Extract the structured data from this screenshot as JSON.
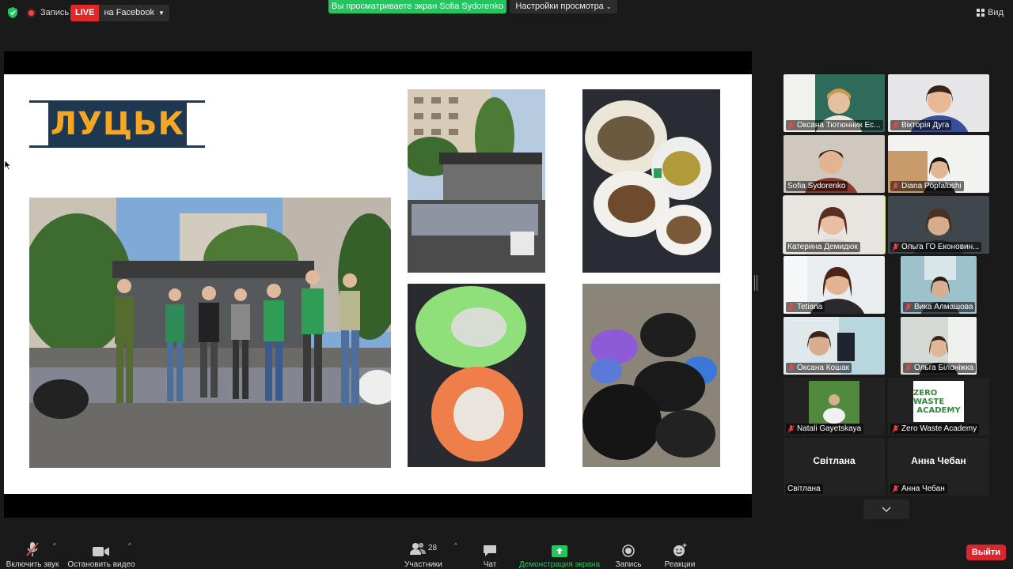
{
  "topbar": {
    "record_label": "Запись",
    "live_badge": "LIVE",
    "live_target": "на Facebook",
    "viewing_banner": "Вы просматриваете экран Sofia Sydorenko",
    "view_options": "Настройки просмотра",
    "view_label": "Вид"
  },
  "slide": {
    "logo_text": "ЛУЦЬК"
  },
  "gallery": {
    "participants": [
      {
        "name": "Оксана Тютюнник Ec...",
        "muted": true
      },
      {
        "name": "Вікторія Дуга",
        "muted": true
      },
      {
        "name": "Sofia Sydorenko",
        "muted": false
      },
      {
        "name": "Diana Popfalushi",
        "muted": true
      },
      {
        "name": "Катерина Демидюк",
        "muted": false,
        "active": true
      },
      {
        "name": "Ольга  ГО Еконовин...",
        "muted": true
      },
      {
        "name": "Tetiana",
        "muted": true
      },
      {
        "name": "Вика Алмашова",
        "muted": true
      },
      {
        "name": "Оксана Кошак",
        "muted": true
      },
      {
        "name": "Ольга Білонiжка",
        "muted": true
      },
      {
        "name": "Natali Gayetskaya",
        "muted": true
      },
      {
        "name": "Zero Waste Academy",
        "muted": true
      },
      {
        "name": "Світлана",
        "muted": false,
        "display": "Світлана"
      },
      {
        "name": "Анна Чебан",
        "muted": true,
        "display": "Анна Чебан"
      }
    ],
    "zwa_logo_line1": "ZERO WASTE",
    "zwa_logo_line2": "ACADEMY"
  },
  "toolbar": {
    "unmute": "Включить звук",
    "stop_video": "Остановить видео",
    "participants": "Участники",
    "participants_count": "28",
    "chat": "Чат",
    "share_screen": "Демонстрация экрана",
    "record": "Запись",
    "reactions": "Реакции",
    "leave": "Выйти"
  },
  "colors": {
    "accent_green": "#22c55e",
    "live_red": "#e02828",
    "leave_red": "#d9262c",
    "active_speaker": "#c8e65a",
    "logo_blue": "#1e3852",
    "logo_orange": "#f5a623"
  }
}
